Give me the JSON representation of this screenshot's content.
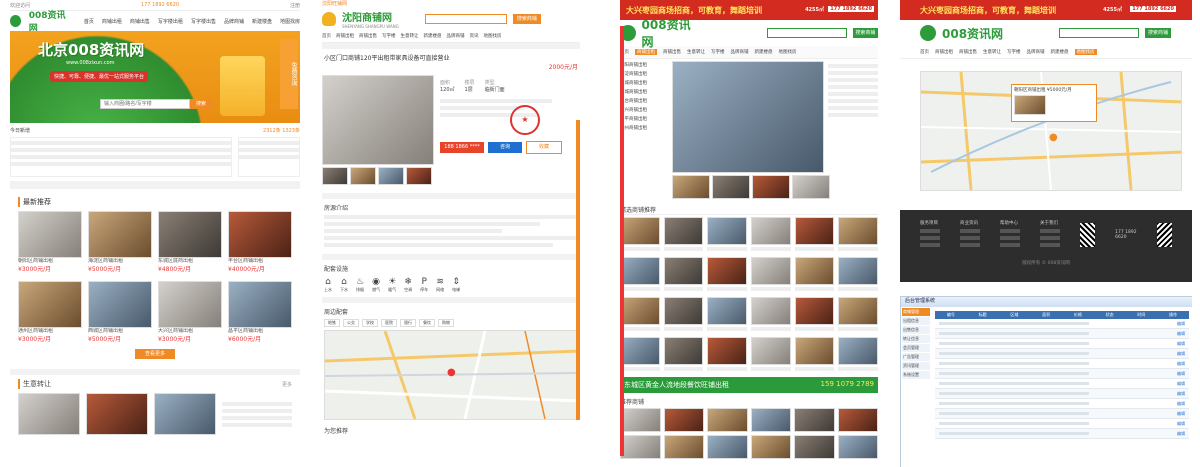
{
  "panel1": {
    "topbar": {
      "greet": "欢迎访问",
      "phone": "177 1892 6620",
      "link": "注册"
    },
    "brand": "008资讯网",
    "nav": [
      "首页",
      "商铺出租",
      "商铺出售",
      "写字楼出租",
      "写字楼出售",
      "品牌商铺",
      "新建楼盘",
      "地图找房"
    ],
    "banner": {
      "city": "北京008资讯网",
      "url": "www.008zixun.com",
      "tagline": "快捷、可靠、便捷、最优一站式服务平台",
      "search_placeholder": "输入商圈/路名/写字楼",
      "search_button": "搜索",
      "side_text": "免费咨询"
    },
    "stats": {
      "label": "今日新增",
      "count1": "2312条",
      "count2": "1323条"
    },
    "hot_title": "最新推荐",
    "hot_items": [
      {
        "caption": "朝阳区商铺出租",
        "price": "¥3000元/月"
      },
      {
        "caption": "海淀区商铺出租",
        "price": "¥5000元/月"
      },
      {
        "caption": "东城区底商出租",
        "price": "¥4800元/月"
      },
      {
        "caption": "丰台区商铺出租",
        "price": "¥40000元/月"
      },
      {
        "caption": "通州区商铺出租",
        "price": "¥3000元/月"
      },
      {
        "caption": "西城区商铺出租",
        "price": "¥5000元/月"
      },
      {
        "caption": "大兴区商铺出租",
        "price": "¥3000元/月"
      },
      {
        "caption": "昌平区商铺出租",
        "price": "¥6000元/月"
      }
    ],
    "more_button": "查看更多",
    "section2_title": "生意转让",
    "section2_more": "更多"
  },
  "panel2": {
    "topbar": "沈阳旺铺网",
    "brand": "沈阳商铺网",
    "brand_sub": "SHENYANG SHANGPU WANG",
    "search_button": "搜索商铺",
    "nav": [
      "首页",
      "商铺出租",
      "商铺出售",
      "写字楼",
      "生意转让",
      "新建楼盘",
      "品牌商铺",
      "资讯",
      "地图找房"
    ],
    "title": "小区门口商铺120平出租带家具设备可直接营业",
    "price": "2000元/月",
    "info": [
      {
        "label": "面积",
        "value": "120㎡"
      },
      {
        "label": "楼层",
        "value": "1层"
      },
      {
        "label": "类型",
        "value": "临街门面"
      }
    ],
    "phone": "188 1866 ****",
    "btn_chat": "咨询",
    "btn_collect": "收藏",
    "detail_title": "房源介绍",
    "facilities_title": "配套设施",
    "facilities": [
      "上水",
      "下水",
      "排烟",
      "燃气",
      "暖气",
      "空调",
      "停车",
      "网络",
      "电梯"
    ],
    "map_title": "周边配套",
    "map_tabs": [
      "地铁",
      "公交",
      "学校",
      "医院",
      "银行",
      "餐饮",
      "购物"
    ],
    "bottom_title": "为您推荐"
  },
  "panel3": {
    "ad_banner": "大兴枣园商场招商，可教育，舞蹈培训",
    "ad_phone": "177 1892 6620",
    "ad_price": "4255㎡",
    "brand": "008资讯网",
    "search_button": "搜索商铺",
    "nav": [
      "首页",
      "商铺出租",
      "商铺出售",
      "生意转让",
      "写字楼",
      "品牌商铺",
      "新建楼盘",
      "地图找房"
    ],
    "category_items": [
      "朝阳商铺出租",
      "海淀商铺出租",
      "东城商铺出租",
      "西城商铺出租",
      "丰台商铺出租",
      "大兴商铺出租",
      "昌平商铺出租",
      "通州商铺出租"
    ],
    "section_title": "精选商铺推荐",
    "ad2": "东城区黄金人流地段餐饮旺铺出租",
    "ad2_phone": "159 1079 2789",
    "section_title2": "推荐商铺"
  },
  "panel4": {
    "ad_banner": "大兴枣园商场招商，可教育，舞蹈培训",
    "ad_phone": "177 1892 6620",
    "ad_price": "4255㎡",
    "brand": "008资讯网",
    "search_button": "搜索商铺",
    "nav": [
      "首页",
      "商铺出租",
      "商铺出售",
      "生意转让",
      "写字楼",
      "品牌商铺",
      "新建楼盘",
      "地图找房"
    ],
    "map_popup": "朝阳区商铺出租 ¥5000元/月",
    "footer": {
      "cols": [
        "服务项目",
        "商业资讯",
        "帮助中心",
        "关于我们"
      ],
      "phone": "177 1892 6620",
      "copy": "版权所有 © 008资讯网"
    },
    "admin": {
      "title": "后台管理系统",
      "sidebar": [
        "商铺管理",
        "出租信息",
        "出售信息",
        "转让信息",
        "会员管理",
        "广告管理",
        "资讯管理",
        "系统设置"
      ],
      "columns": [
        "编号",
        "标题",
        "区域",
        "面积",
        "价格",
        "状态",
        "时间",
        "操作"
      ],
      "action": "编辑"
    }
  }
}
